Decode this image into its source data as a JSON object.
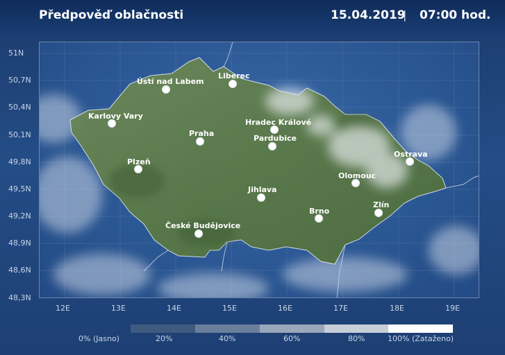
{
  "header": {
    "title": "Předpověď oblačnosti",
    "date": "15.04.2019",
    "separator": "|",
    "time": "07:00 hod."
  },
  "map": {
    "y_axis_labels": [
      "51N",
      "50,7N",
      "50,4N",
      "50,1N",
      "49,8N",
      "49,5N",
      "49,2N",
      "48,9N",
      "48,6N",
      "48,3N"
    ],
    "x_axis_labels": [
      "12E",
      "13E",
      "14E",
      "15E",
      "16E",
      "17E",
      "18E",
      "19E"
    ],
    "cities": [
      {
        "name": "Ústí nad Labem"
      },
      {
        "name": "Liberec"
      },
      {
        "name": "Karlovy Vary"
      },
      {
        "name": "Hradec Králové"
      },
      {
        "name": "Praha"
      },
      {
        "name": "Pardubice"
      },
      {
        "name": "Ostrava"
      },
      {
        "name": "Plzeň"
      },
      {
        "name": "Olomouc"
      },
      {
        "name": "Jihlava"
      },
      {
        "name": "Brno"
      },
      {
        "name": "Zlín"
      },
      {
        "name": "České Budějovice"
      }
    ]
  },
  "legend": {
    "labels": [
      "0% (Jasno)",
      "20%",
      "40%",
      "60%",
      "80%",
      "100% (Zataženo)"
    ],
    "colors": [
      "#3f5a7f",
      "#6b7f9c",
      "#9aa8bb",
      "#c7ced8",
      "#ffffff"
    ]
  }
}
